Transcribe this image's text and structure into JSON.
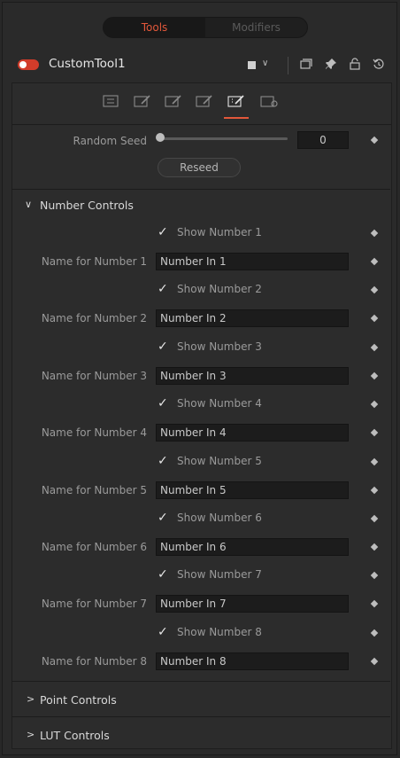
{
  "modes": {
    "tools": "Tools",
    "modifiers": "Modifiers"
  },
  "header": {
    "tool_name": "CustomTool1",
    "color_chevron": "∨"
  },
  "controls": {
    "random_seed_label": "Random Seed",
    "random_seed_value": "0",
    "reseed_label": "Reseed"
  },
  "number_controls": {
    "title": "Number Controls",
    "items": [
      {
        "show_label": "Show Number 1",
        "name_label": "Name for Number 1",
        "name_value": "Number In 1"
      },
      {
        "show_label": "Show Number 2",
        "name_label": "Name for Number 2",
        "name_value": "Number In 2"
      },
      {
        "show_label": "Show Number 3",
        "name_label": "Name for Number 3",
        "name_value": "Number In 3"
      },
      {
        "show_label": "Show Number 4",
        "name_label": "Name for Number 4",
        "name_value": "Number In 4"
      },
      {
        "show_label": "Show Number 5",
        "name_label": "Name for Number 5",
        "name_value": "Number In 5"
      },
      {
        "show_label": "Show Number 6",
        "name_label": "Name for Number 6",
        "name_value": "Number In 6"
      },
      {
        "show_label": "Show Number 7",
        "name_label": "Name for Number 7",
        "name_value": "Number In 7"
      },
      {
        "show_label": "Show Number 8",
        "name_label": "Name for Number 8",
        "name_value": "Number In 8"
      }
    ]
  },
  "sections": {
    "point_controls": "Point Controls",
    "lut_controls": "LUT Controls"
  },
  "glyphs": {
    "check": "✓",
    "expanded": "∨",
    "collapsed": ">"
  },
  "colors": {
    "accent": "#e2573a",
    "toggle": "#d23c2a"
  }
}
